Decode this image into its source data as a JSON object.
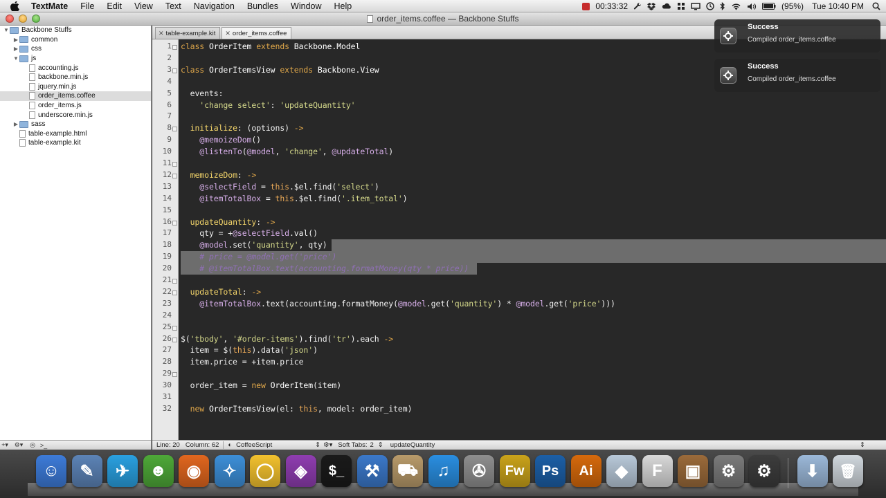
{
  "menubar": {
    "app": "TextMate",
    "items": [
      "File",
      "Edit",
      "View",
      "Text",
      "Navigation",
      "Bundles",
      "Window",
      "Help"
    ],
    "timer": "00:33:32",
    "battery": "(95%)",
    "clock": "Tue 10:40 PM"
  },
  "window": {
    "title": "order_items.coffee — Backbone Stuffs"
  },
  "sidebar": {
    "root": "Backbone Stuffs",
    "items": [
      {
        "label": "common",
        "type": "folder",
        "depth": 1,
        "open": false
      },
      {
        "label": "css",
        "type": "folder",
        "depth": 1,
        "open": false
      },
      {
        "label": "js",
        "type": "folder",
        "depth": 1,
        "open": true
      },
      {
        "label": "accounting.js",
        "type": "file",
        "depth": 2
      },
      {
        "label": "backbone.min.js",
        "type": "file",
        "depth": 2
      },
      {
        "label": "jquery.min.js",
        "type": "file",
        "depth": 2
      },
      {
        "label": "order_items.coffee",
        "type": "file",
        "depth": 2,
        "selected": true
      },
      {
        "label": "order_items.js",
        "type": "file",
        "depth": 2
      },
      {
        "label": "underscore.min.js",
        "type": "file",
        "depth": 2
      },
      {
        "label": "sass",
        "type": "folder",
        "depth": 1,
        "open": false
      },
      {
        "label": "table-example.html",
        "type": "file",
        "depth": 1
      },
      {
        "label": "table-example.kit",
        "type": "file",
        "depth": 1
      }
    ]
  },
  "tabs": [
    {
      "label": "table-example.kit",
      "active": false
    },
    {
      "label": "order_items.coffee",
      "active": true
    }
  ],
  "code": {
    "lines": [
      "class OrderItem extends Backbone.Model",
      "",
      "class OrderItemsView extends Backbone.View",
      "",
      "  events:",
      "    'change select': 'updateQuantity'",
      "",
      "  initialize: (options) ->",
      "    @memoizeDom()",
      "    @listenTo(@model, 'change', @updateTotal)",
      "",
      "  memoizeDom: ->",
      "    @selectField = this.$el.find('select')",
      "    @itemTotalBox = this.$el.find('.item_total')",
      "",
      "  updateQuantity: ->",
      "    qty = +@selectField.val()",
      "    @model.set('quantity', qty)",
      "    # price = @model.get('price')",
      "    # @itemTotalBox.text(accounting.formatMoney(qty * price))",
      "",
      "  updateTotal: ->",
      "    @itemTotalBox.text(accounting.formatMoney(@model.get('quantity') * @model.get('price')))",
      "",
      "",
      "$('tbody', '#order-items').find('tr').each ->",
      "  item = $(this).data('json')",
      "  item.price = +item.price",
      "",
      "  order_item = new OrderItem(item)",
      "",
      "  new OrderItemsView(el: this, model: order_item)"
    ],
    "fold_lines": [
      1,
      3,
      8,
      11,
      12,
      16,
      21,
      22,
      25,
      26,
      29
    ]
  },
  "statusbar": {
    "line": "Line: 20",
    "column": "Column: 62",
    "language": "CoffeeScript",
    "tabs_label": "Soft Tabs:",
    "tabs_value": "2",
    "symbol": "updateQuantity"
  },
  "notifications": [
    {
      "title": "Success",
      "message": "Compiled order_items.coffee"
    },
    {
      "title": "Success",
      "message": "Compiled order_items.coffee"
    }
  ],
  "dock": {
    "apps": [
      {
        "name": "Finder",
        "color": "#3d7bd8",
        "glyph": "☺"
      },
      {
        "name": "Preview",
        "color": "#5c83b6",
        "glyph": "✎"
      },
      {
        "name": "Twitter",
        "color": "#2aa0e0",
        "glyph": "✈"
      },
      {
        "name": "Adium",
        "color": "#4ea838",
        "glyph": "☻"
      },
      {
        "name": "Firefox",
        "color": "#e0661e",
        "glyph": "◉"
      },
      {
        "name": "Safari",
        "color": "#3d8fd8",
        "glyph": "✧"
      },
      {
        "name": "Chrome",
        "color": "#f2c12e",
        "glyph": "◯"
      },
      {
        "name": "Pixelmator",
        "color": "#8f3db0",
        "glyph": "◈"
      },
      {
        "name": "Terminal",
        "color": "#1a1a1a",
        "glyph": "$_"
      },
      {
        "name": "Xcode",
        "color": "#3b78c9",
        "glyph": "⚒"
      },
      {
        "name": "Transmit",
        "color": "#b89a6a",
        "glyph": "⛟"
      },
      {
        "name": "iTunes",
        "color": "#2a8ee0",
        "glyph": "♫"
      },
      {
        "name": "Disk Utility",
        "color": "#8e8e8e",
        "glyph": "✇"
      },
      {
        "name": "Fireworks",
        "color": "#c9a21a",
        "glyph": "Fw"
      },
      {
        "name": "Photoshop",
        "color": "#1c5fa6",
        "glyph": "Ps"
      },
      {
        "name": "Illustrator",
        "color": "#d5690c",
        "glyph": "Ai"
      },
      {
        "name": "Sketch",
        "color": "#b8c8d8",
        "glyph": "◆"
      },
      {
        "name": "Font Book",
        "color": "#d8d8d8",
        "glyph": "F"
      },
      {
        "name": "Image Capture",
        "color": "#9a6a3a",
        "glyph": "▣"
      },
      {
        "name": "System Preferences",
        "color": "#7a7a7a",
        "glyph": "⚙"
      },
      {
        "name": "CodeKit",
        "color": "#3c3c3c",
        "glyph": "⚙"
      },
      {
        "name": "Downloads",
        "color": "#9bb8d8",
        "glyph": "⬇"
      },
      {
        "name": "Trash",
        "color": "#cfd6dc",
        "glyph": "🗑"
      }
    ]
  }
}
